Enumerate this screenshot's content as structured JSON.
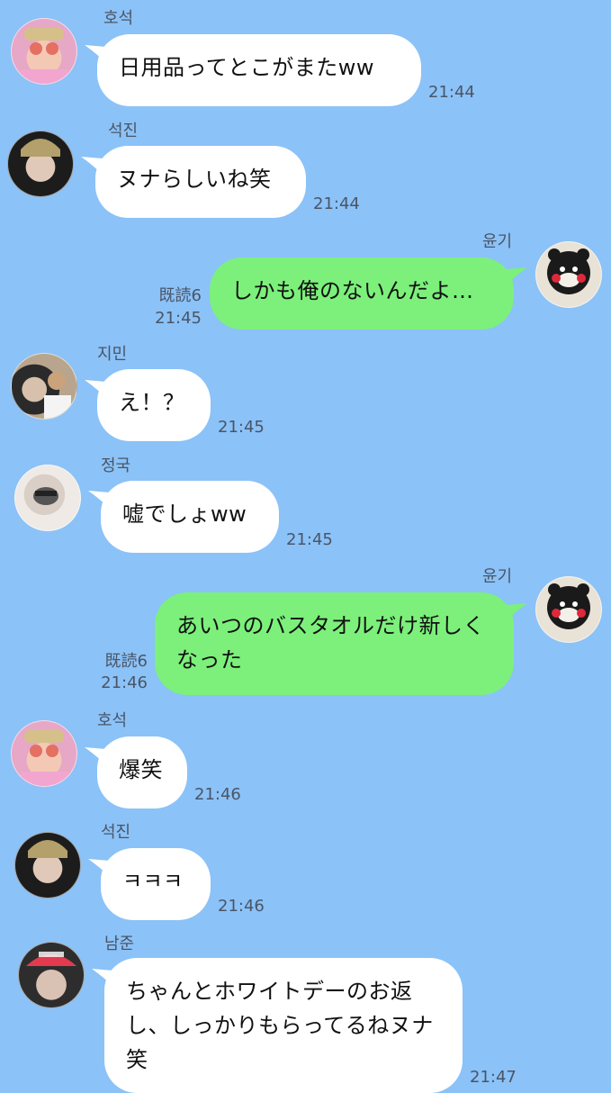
{
  "messages": [
    {
      "sender": "호석",
      "text": "日用品ってとこがまたww",
      "time": "21:44"
    },
    {
      "sender": "석진",
      "text": "ヌナらしいね笑",
      "time": "21:44"
    },
    {
      "sender": "윤기",
      "text": "しかも俺のないんだよ…",
      "time": "21:45",
      "read": "既読6"
    },
    {
      "sender": "지민",
      "text": "え！？",
      "time": "21:45"
    },
    {
      "sender": "정국",
      "text": "嘘でしょww",
      "time": "21:45"
    },
    {
      "sender": "윤기",
      "text": "あいつのバスタオルだけ新しくなった",
      "time": "21:46",
      "read": "既読6"
    },
    {
      "sender": "호석",
      "text": "爆笑",
      "time": "21:46"
    },
    {
      "sender": "석진",
      "text": "ㅋㅋㅋ",
      "time": "21:46"
    },
    {
      "sender": "남준",
      "text": "ちゃんとホワイトデーのお返し、しっかりもらってるねヌナ笑",
      "time": "21:47"
    }
  ],
  "colors": {
    "background": "#8bc2f8",
    "incoming": "#ffffff",
    "outgoing": "#7cf07b"
  }
}
